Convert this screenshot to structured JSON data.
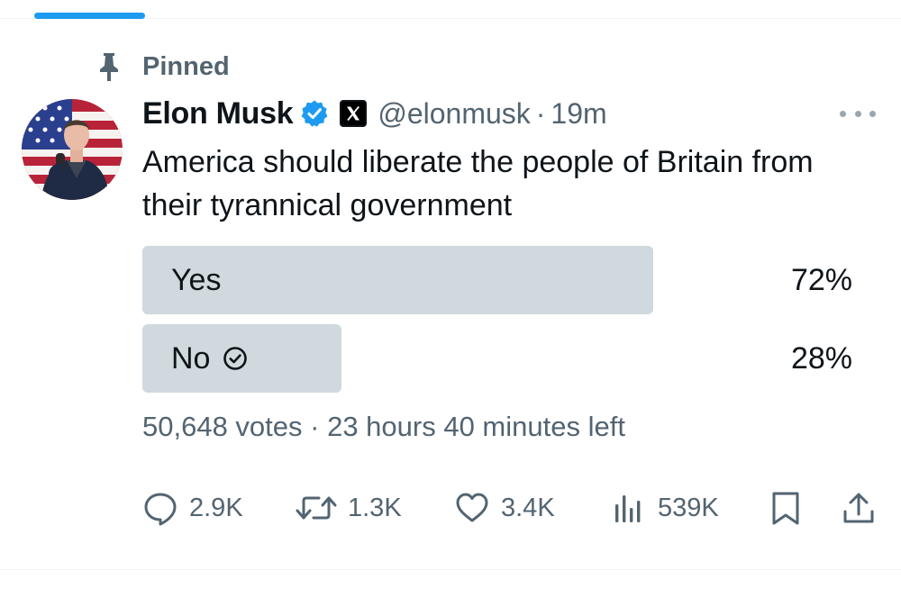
{
  "pinned": {
    "label": "Pinned"
  },
  "author": {
    "display_name": "Elon Musk",
    "handle": "@elonmusk",
    "separator": "·",
    "timestamp": "19m",
    "verified": true
  },
  "tweet": {
    "text": "America should liberate the people of Britain from their tyrannical government"
  },
  "poll": {
    "options": [
      {
        "label": "Yes",
        "percent": "72%",
        "fraction": 0.72,
        "selected": false
      },
      {
        "label": "No",
        "percent": "28%",
        "fraction": 0.28,
        "selected": true
      }
    ],
    "meta": "50,648 votes · 23 hours 40 minutes left"
  },
  "actions": {
    "replies": "2.9K",
    "reposts": "1.3K",
    "likes": "3.4K",
    "views": "539K"
  },
  "icons": {
    "pin": "pin-icon",
    "verified": "verified-badge-icon",
    "x_logo": "x-logo-icon",
    "more": "more-options-icon",
    "check": "check-circle-icon",
    "reply": "reply-icon",
    "repost": "repost-icon",
    "like": "heart-icon",
    "views": "views-chart-icon",
    "bookmark": "bookmark-icon",
    "share": "share-icon"
  },
  "colors": {
    "accent": "#1d9bf0",
    "text": "#0f1419",
    "secondary_text": "#536471",
    "poll_bar": "#cfd9de"
  }
}
